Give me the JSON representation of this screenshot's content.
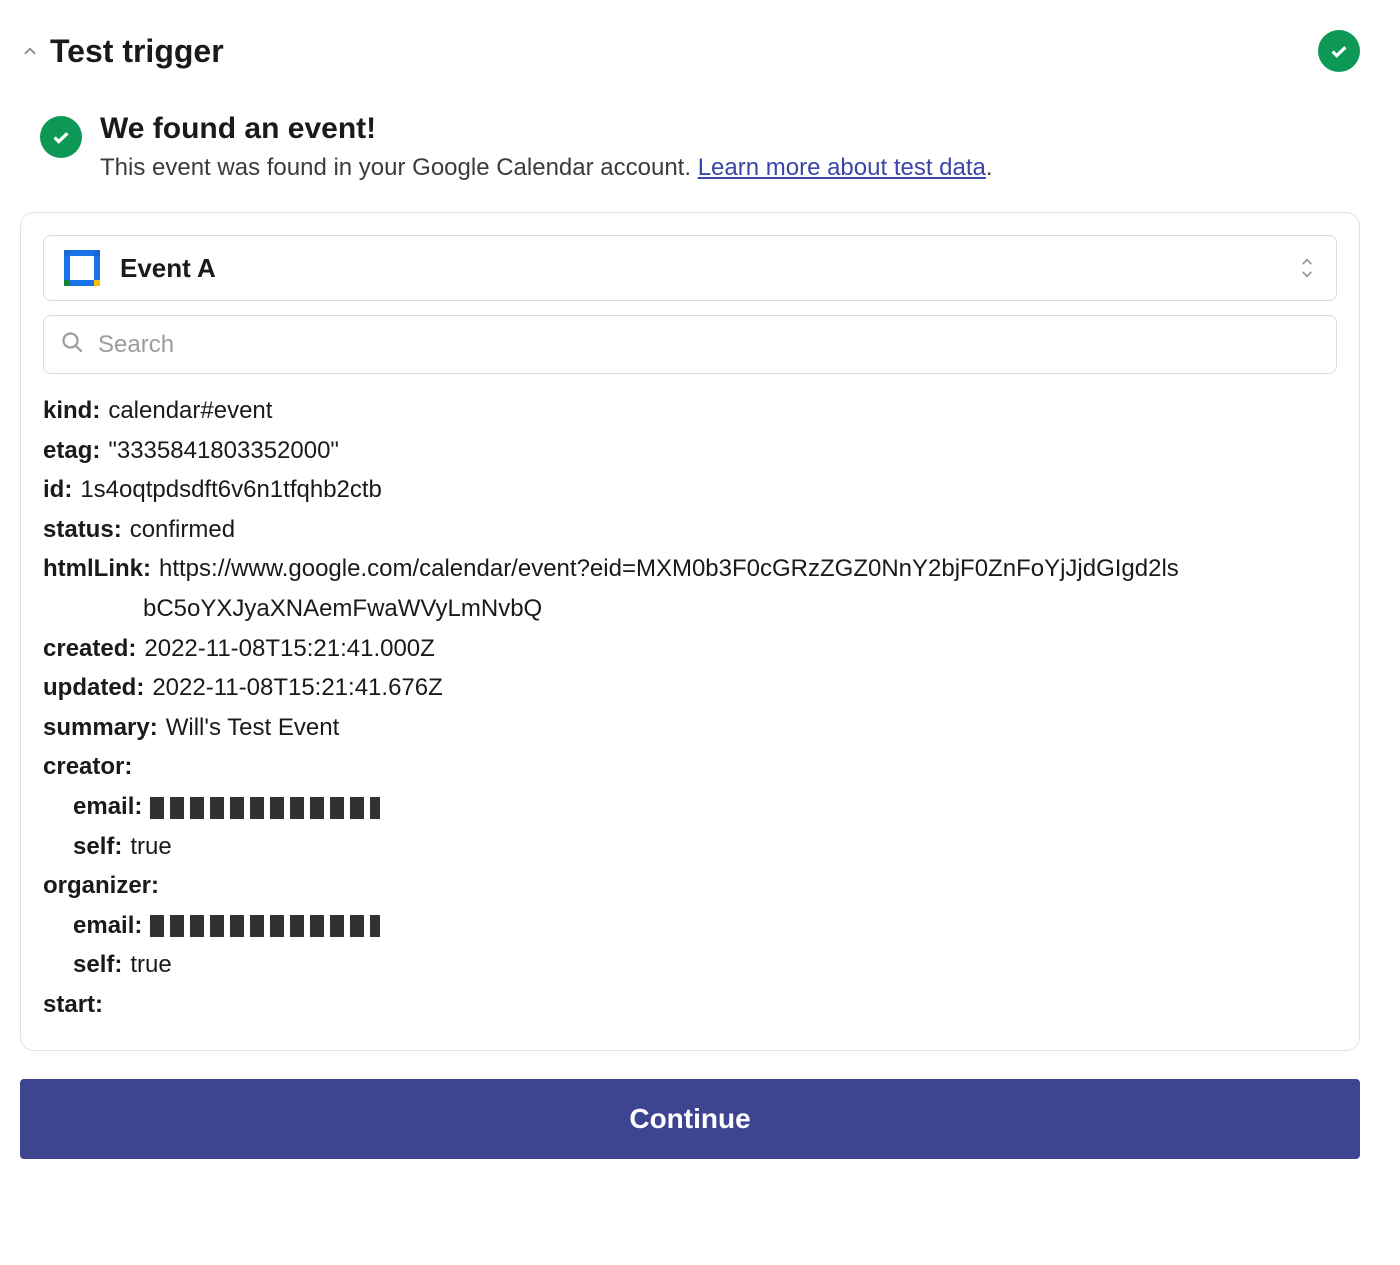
{
  "header": {
    "title": "Test trigger"
  },
  "found": {
    "title": "We found an event!",
    "subtitle": "This event was found in your Google Calendar account. ",
    "link_text": "Learn more about test data",
    "period": "."
  },
  "selector": {
    "event_name": "Event A"
  },
  "search": {
    "placeholder": "Search"
  },
  "fields": {
    "kind": {
      "label": "kind:",
      "value": "calendar#event"
    },
    "etag": {
      "label": "etag:",
      "value": "\"3335841803352000\""
    },
    "id": {
      "label": "id:",
      "value": "1s4oqtpdsdft6v6n1tfqhb2ctb"
    },
    "status": {
      "label": "status:",
      "value": "confirmed"
    },
    "htmlLink": {
      "label": "htmlLink:",
      "value_line1": "https://www.google.com/calendar/event?eid=MXM0b3F0cGRzZGZ0NnY2bjF0ZnFoYjJjdGIgd2ls",
      "value_line2": "bC5oYXJyaXNAemFwaWVyLmNvbQ"
    },
    "created": {
      "label": "created:",
      "value": "2022-11-08T15:21:41.000Z"
    },
    "updated": {
      "label": "updated:",
      "value": "2022-11-08T15:21:41.676Z"
    },
    "summary": {
      "label": "summary:",
      "value": "Will's Test Event"
    },
    "creator": {
      "label": "creator:"
    },
    "creator_email": {
      "label": "email:"
    },
    "creator_self": {
      "label": "self:",
      "value": "true"
    },
    "organizer": {
      "label": "organizer:"
    },
    "organizer_email": {
      "label": "email:"
    },
    "organizer_self": {
      "label": "self:",
      "value": "true"
    },
    "start": {
      "label": "start:"
    }
  },
  "continue_label": "Continue"
}
